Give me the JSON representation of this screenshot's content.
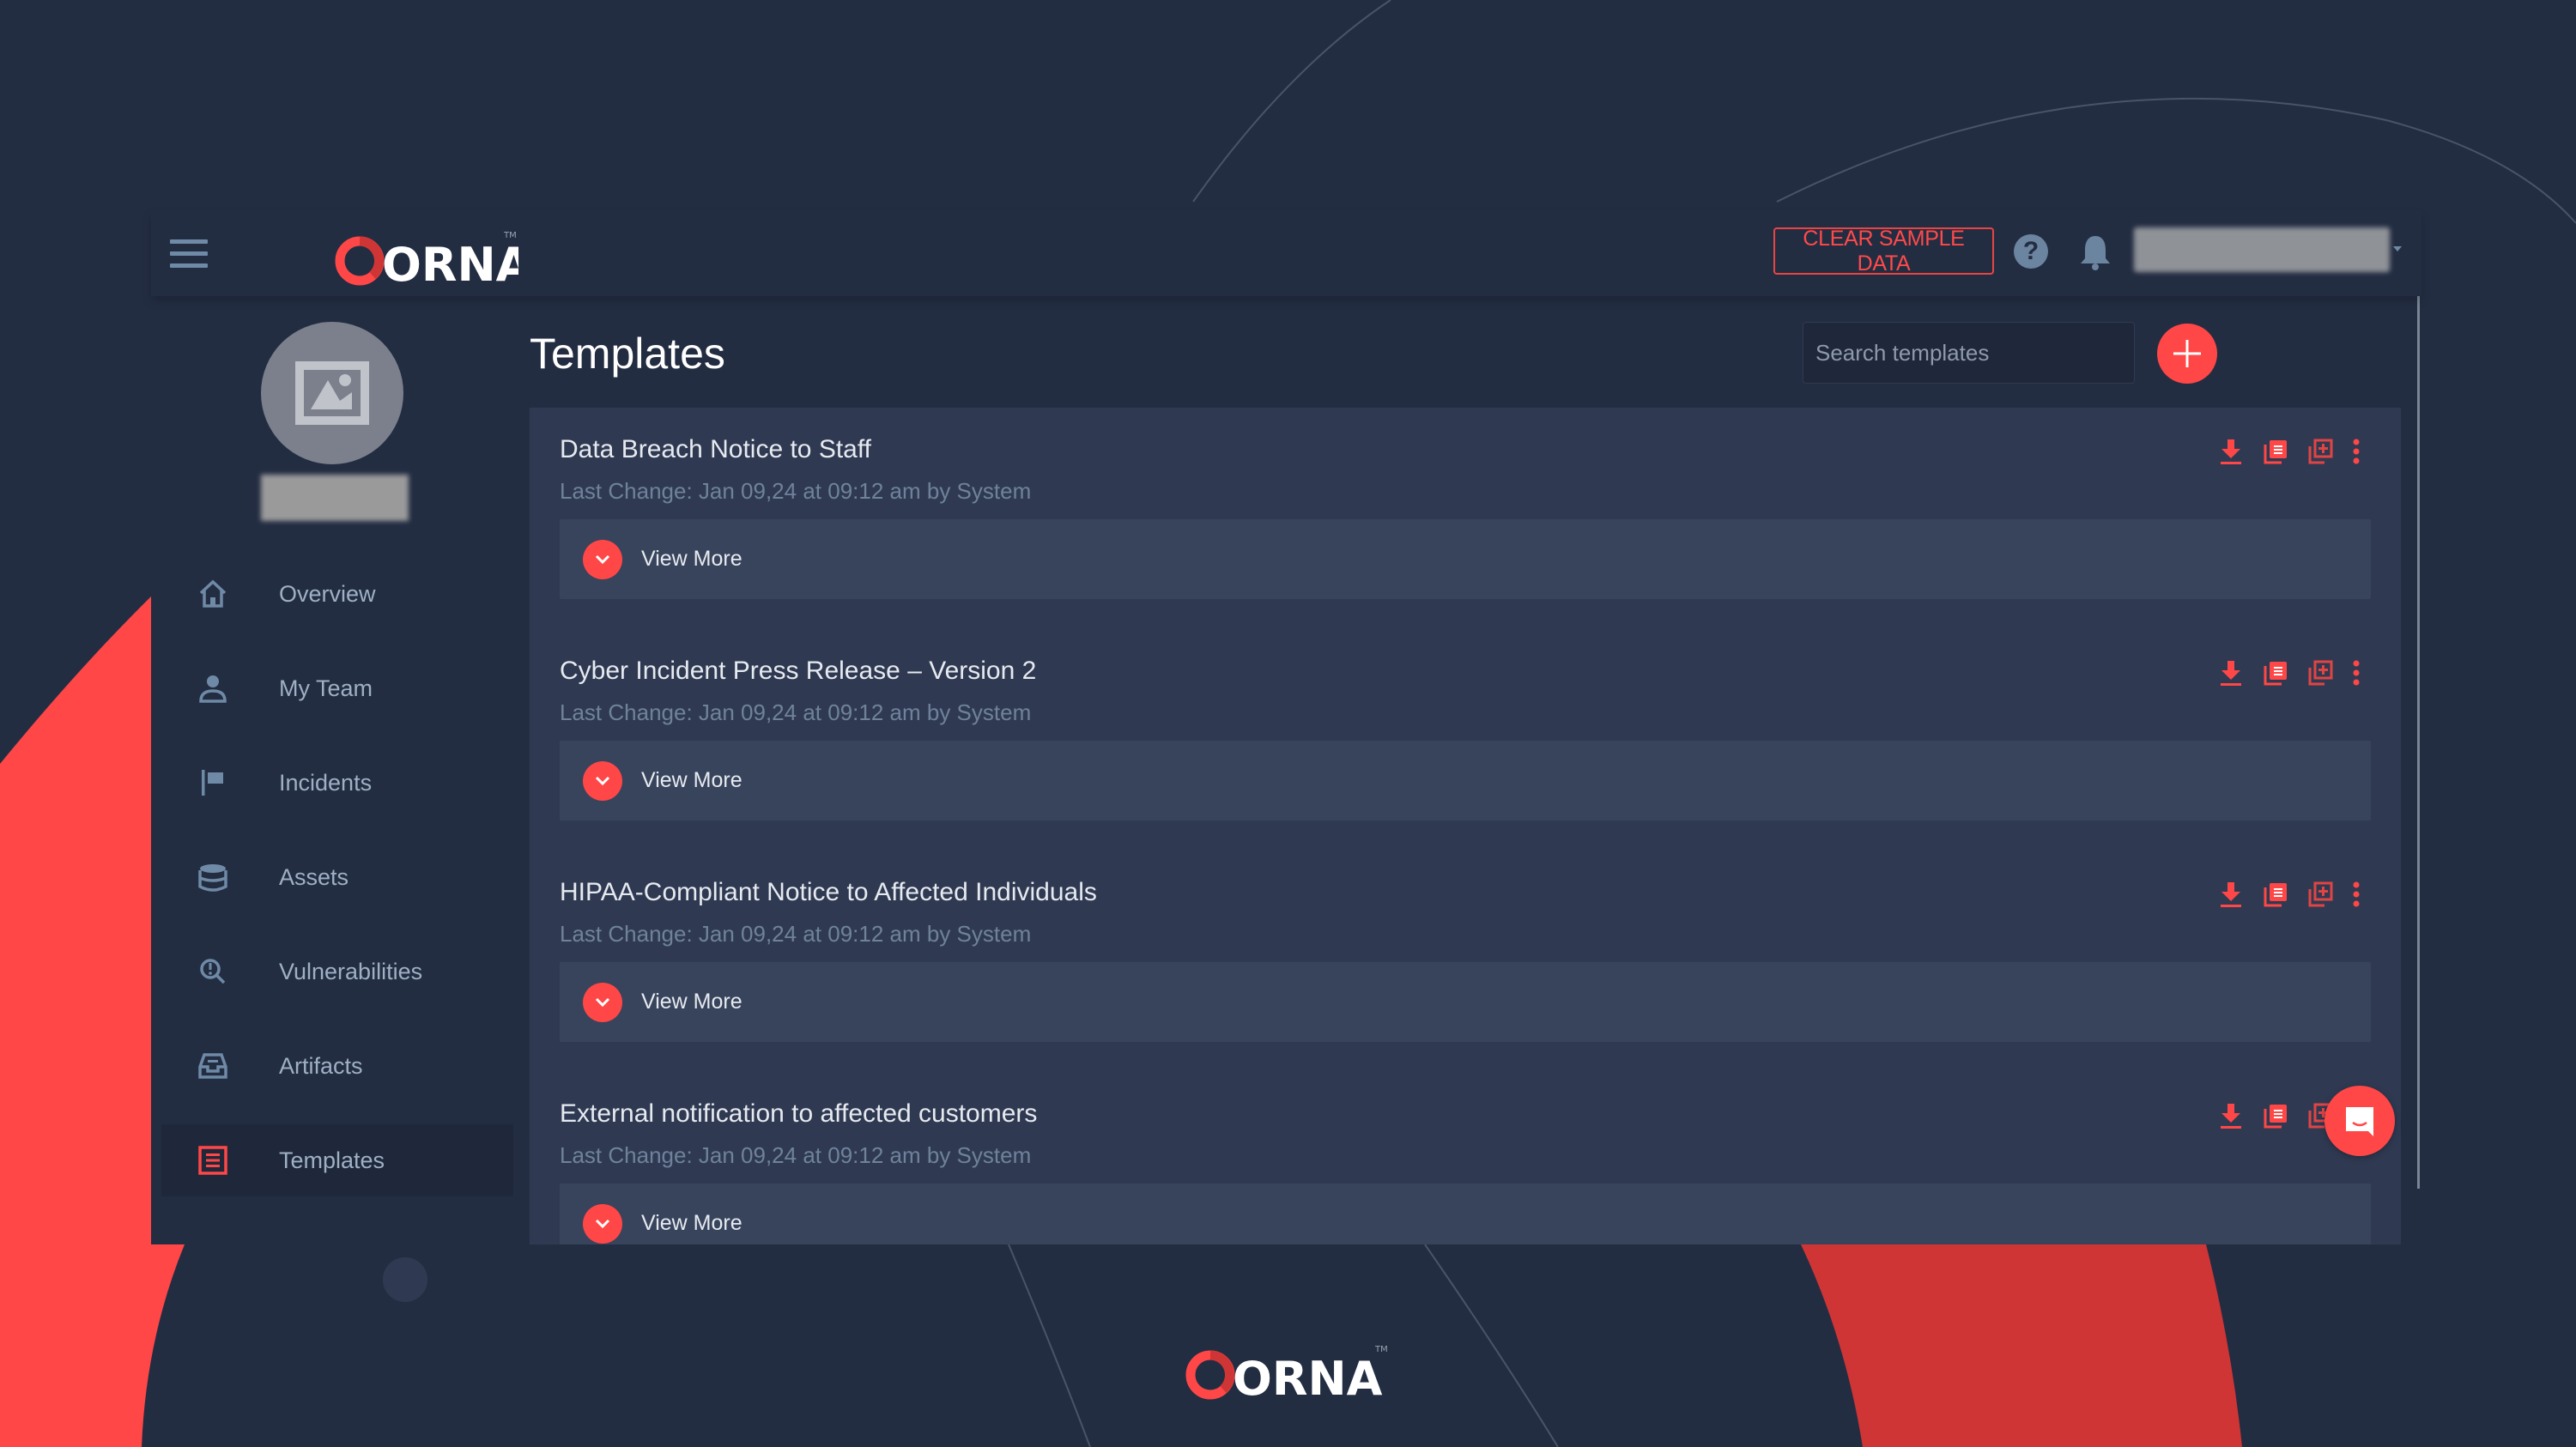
{
  "brand": {
    "name": "ORNA",
    "trademark": "TM",
    "accent": "#ff4747",
    "accent_dark": "#d03535"
  },
  "topbar": {
    "menu_icon": "hamburger-icon",
    "clear_sample_data_label": "CLEAR SAMPLE DATA",
    "help_icon": "question-circle-icon",
    "notifications_icon": "bell-icon",
    "user_menu_caret": "caret-down-icon"
  },
  "sidebar": {
    "avatar_icon": "image-placeholder-icon",
    "items": [
      {
        "label": "Overview",
        "icon": "home-icon",
        "active": false
      },
      {
        "label": "My Team",
        "icon": "user-icon",
        "active": false
      },
      {
        "label": "Incidents",
        "icon": "flag-icon",
        "active": false
      },
      {
        "label": "Assets",
        "icon": "database-icon",
        "active": false
      },
      {
        "label": "Vulnerabilities",
        "icon": "search-alert-icon",
        "active": false
      },
      {
        "label": "Artifacts",
        "icon": "inbox-icon",
        "active": false
      },
      {
        "label": "Templates",
        "icon": "list-document-icon",
        "active": true
      }
    ]
  },
  "main": {
    "title": "Templates",
    "search": {
      "placeholder": "Search templates",
      "value": ""
    },
    "add_icon": "plus-icon",
    "templates": [
      {
        "title": "Data Breach Notice to Staff",
        "meta": "Last Change: Jan 09,24 at 09:12 am by System",
        "view_more": "View More"
      },
      {
        "title": "Cyber Incident Press Release – Version 2",
        "meta": "Last Change: Jan 09,24 at 09:12 am by System",
        "view_more": "View More"
      },
      {
        "title": "HIPAA-Compliant Notice to Affected Individuals",
        "meta": "Last Change: Jan 09,24 at 09:12 am by System",
        "view_more": "View More"
      },
      {
        "title": "External notification to affected customers",
        "meta": "Last Change: Jan 09,24 at 09:12 am by System",
        "view_more": "View More"
      }
    ],
    "card_action_icons": [
      "download-icon",
      "copy-list-icon",
      "duplicate-plus-icon",
      "kebab-menu-icon"
    ]
  },
  "chat": {
    "icon": "chat-smile-icon"
  }
}
